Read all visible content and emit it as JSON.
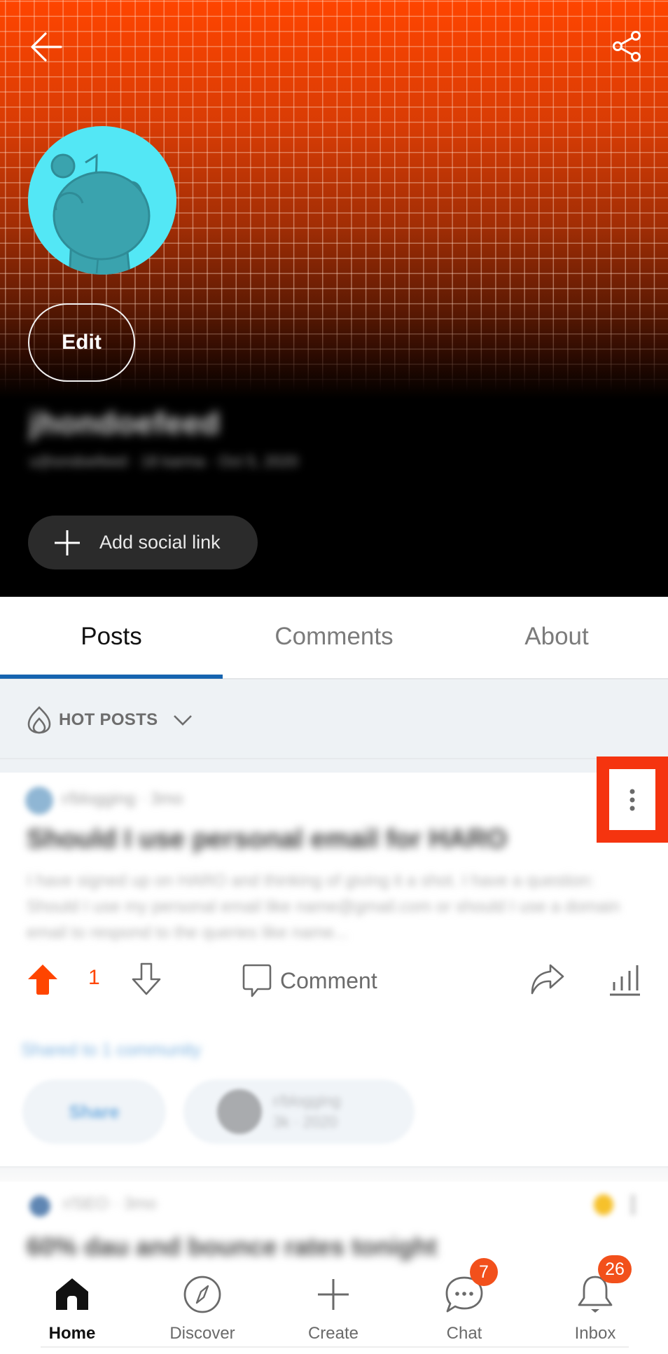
{
  "header": {
    "back_icon": "arrow-left-icon",
    "share_icon": "share-icon",
    "colors": {
      "banner_top": "#FF4500",
      "banner_bottom": "#000000",
      "avatar_bg": "#53E7F5",
      "avatar_figure": "#3AA3AE"
    },
    "edit_label": "Edit",
    "username": "jhondoefeed",
    "user_meta": "u/jhondoefeed · 18 karma · Oct 5, 2020",
    "add_social_label": "Add social link"
  },
  "tabs": [
    {
      "label": "Posts",
      "active": true
    },
    {
      "label": "Comments",
      "active": false
    },
    {
      "label": "About",
      "active": false
    }
  ],
  "sort": {
    "label": "HOT POSTS",
    "icon": "flame-icon"
  },
  "posts": [
    {
      "meta": "r/blogging · 3mo",
      "title": "Should I use personal email for HARO",
      "body": "I have signed up on HARO and thinking of giving it a shot. I have a question: Should I use my personal email like name@gmail.com or should I use a domain email to respond to the queries like name...",
      "vote_count": "1",
      "upvoted": true,
      "comment_label": "Comment",
      "shared_label": "Shared to 1 community",
      "share_chip_label": "Share",
      "community_chip": {
        "name": "r/blogging",
        "meta": "3k · 2020"
      }
    },
    {
      "meta": "r/SEO · 3mo",
      "title": "60% dau and bounce rates tonight"
    }
  ],
  "accent": {
    "upvote": "#FF4500",
    "tab_underline": "#1664B0",
    "highlight_box": "#F5340F",
    "badge": "#F2501B"
  },
  "bottom_nav": [
    {
      "label": "Home",
      "icon": "home-icon",
      "active": true
    },
    {
      "label": "Discover",
      "icon": "compass-icon",
      "active": false
    },
    {
      "label": "Create",
      "icon": "plus-icon",
      "active": false
    },
    {
      "label": "Chat",
      "icon": "chat-icon",
      "active": false,
      "badge": "7"
    },
    {
      "label": "Inbox",
      "icon": "bell-icon",
      "active": false,
      "badge": "26"
    }
  ]
}
